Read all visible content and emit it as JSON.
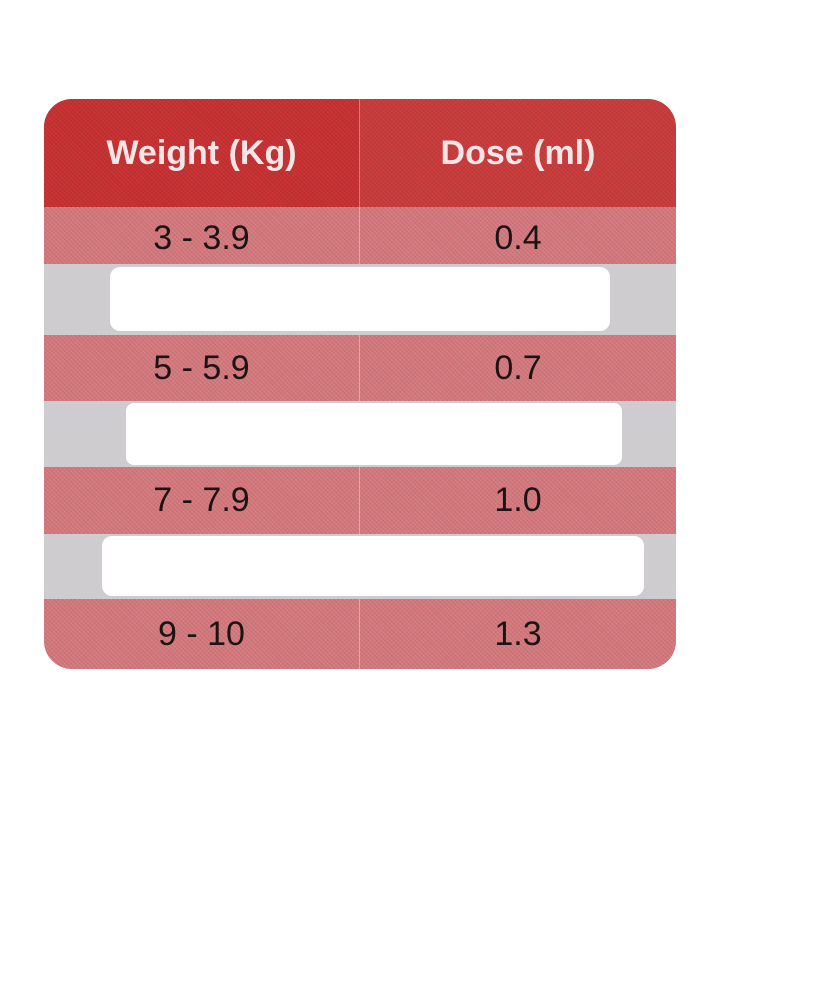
{
  "table": {
    "headers": {
      "weight": "Weight (Kg)",
      "dose": "Dose (ml)"
    },
    "rows": [
      {
        "weight": "3 - 3.9",
        "dose": "0.4"
      },
      {
        "weight": "5 - 5.9",
        "dose": "0.7"
      },
      {
        "weight": "7 - 7.9",
        "dose": "1.0"
      },
      {
        "weight": "9 - 10",
        "dose": "1.3"
      }
    ]
  },
  "colors": {
    "header_red": "#c73a3a",
    "row_pink": "#d0767b",
    "gap_grey": "#cfcccf",
    "text_dark": "#1c1414",
    "header_text": "#f4e6e6"
  }
}
